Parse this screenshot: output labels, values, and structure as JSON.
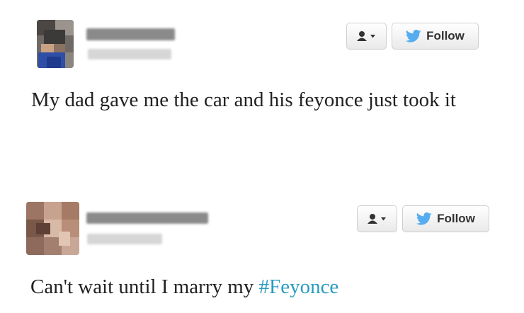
{
  "colors": {
    "text": "#222222",
    "hashtag": "#2a9bbf",
    "twitter_bird": "#55acee",
    "button_border": "#cfcfcf"
  },
  "tweets": [
    {
      "name": "",
      "handle": "",
      "follow_label": "Follow",
      "user_menu_icon": "user-dropdown-icon",
      "follow_icon": "twitter-bird-icon",
      "text": "My dad gave me the car and his feyonce just took it"
    },
    {
      "name": "",
      "handle": "",
      "follow_label": "Follow",
      "user_menu_icon": "user-dropdown-icon",
      "follow_icon": "twitter-bird-icon",
      "text_before_hashtag": "Can't wait until I marry my ",
      "hashtag": "#Feyonce"
    }
  ]
}
